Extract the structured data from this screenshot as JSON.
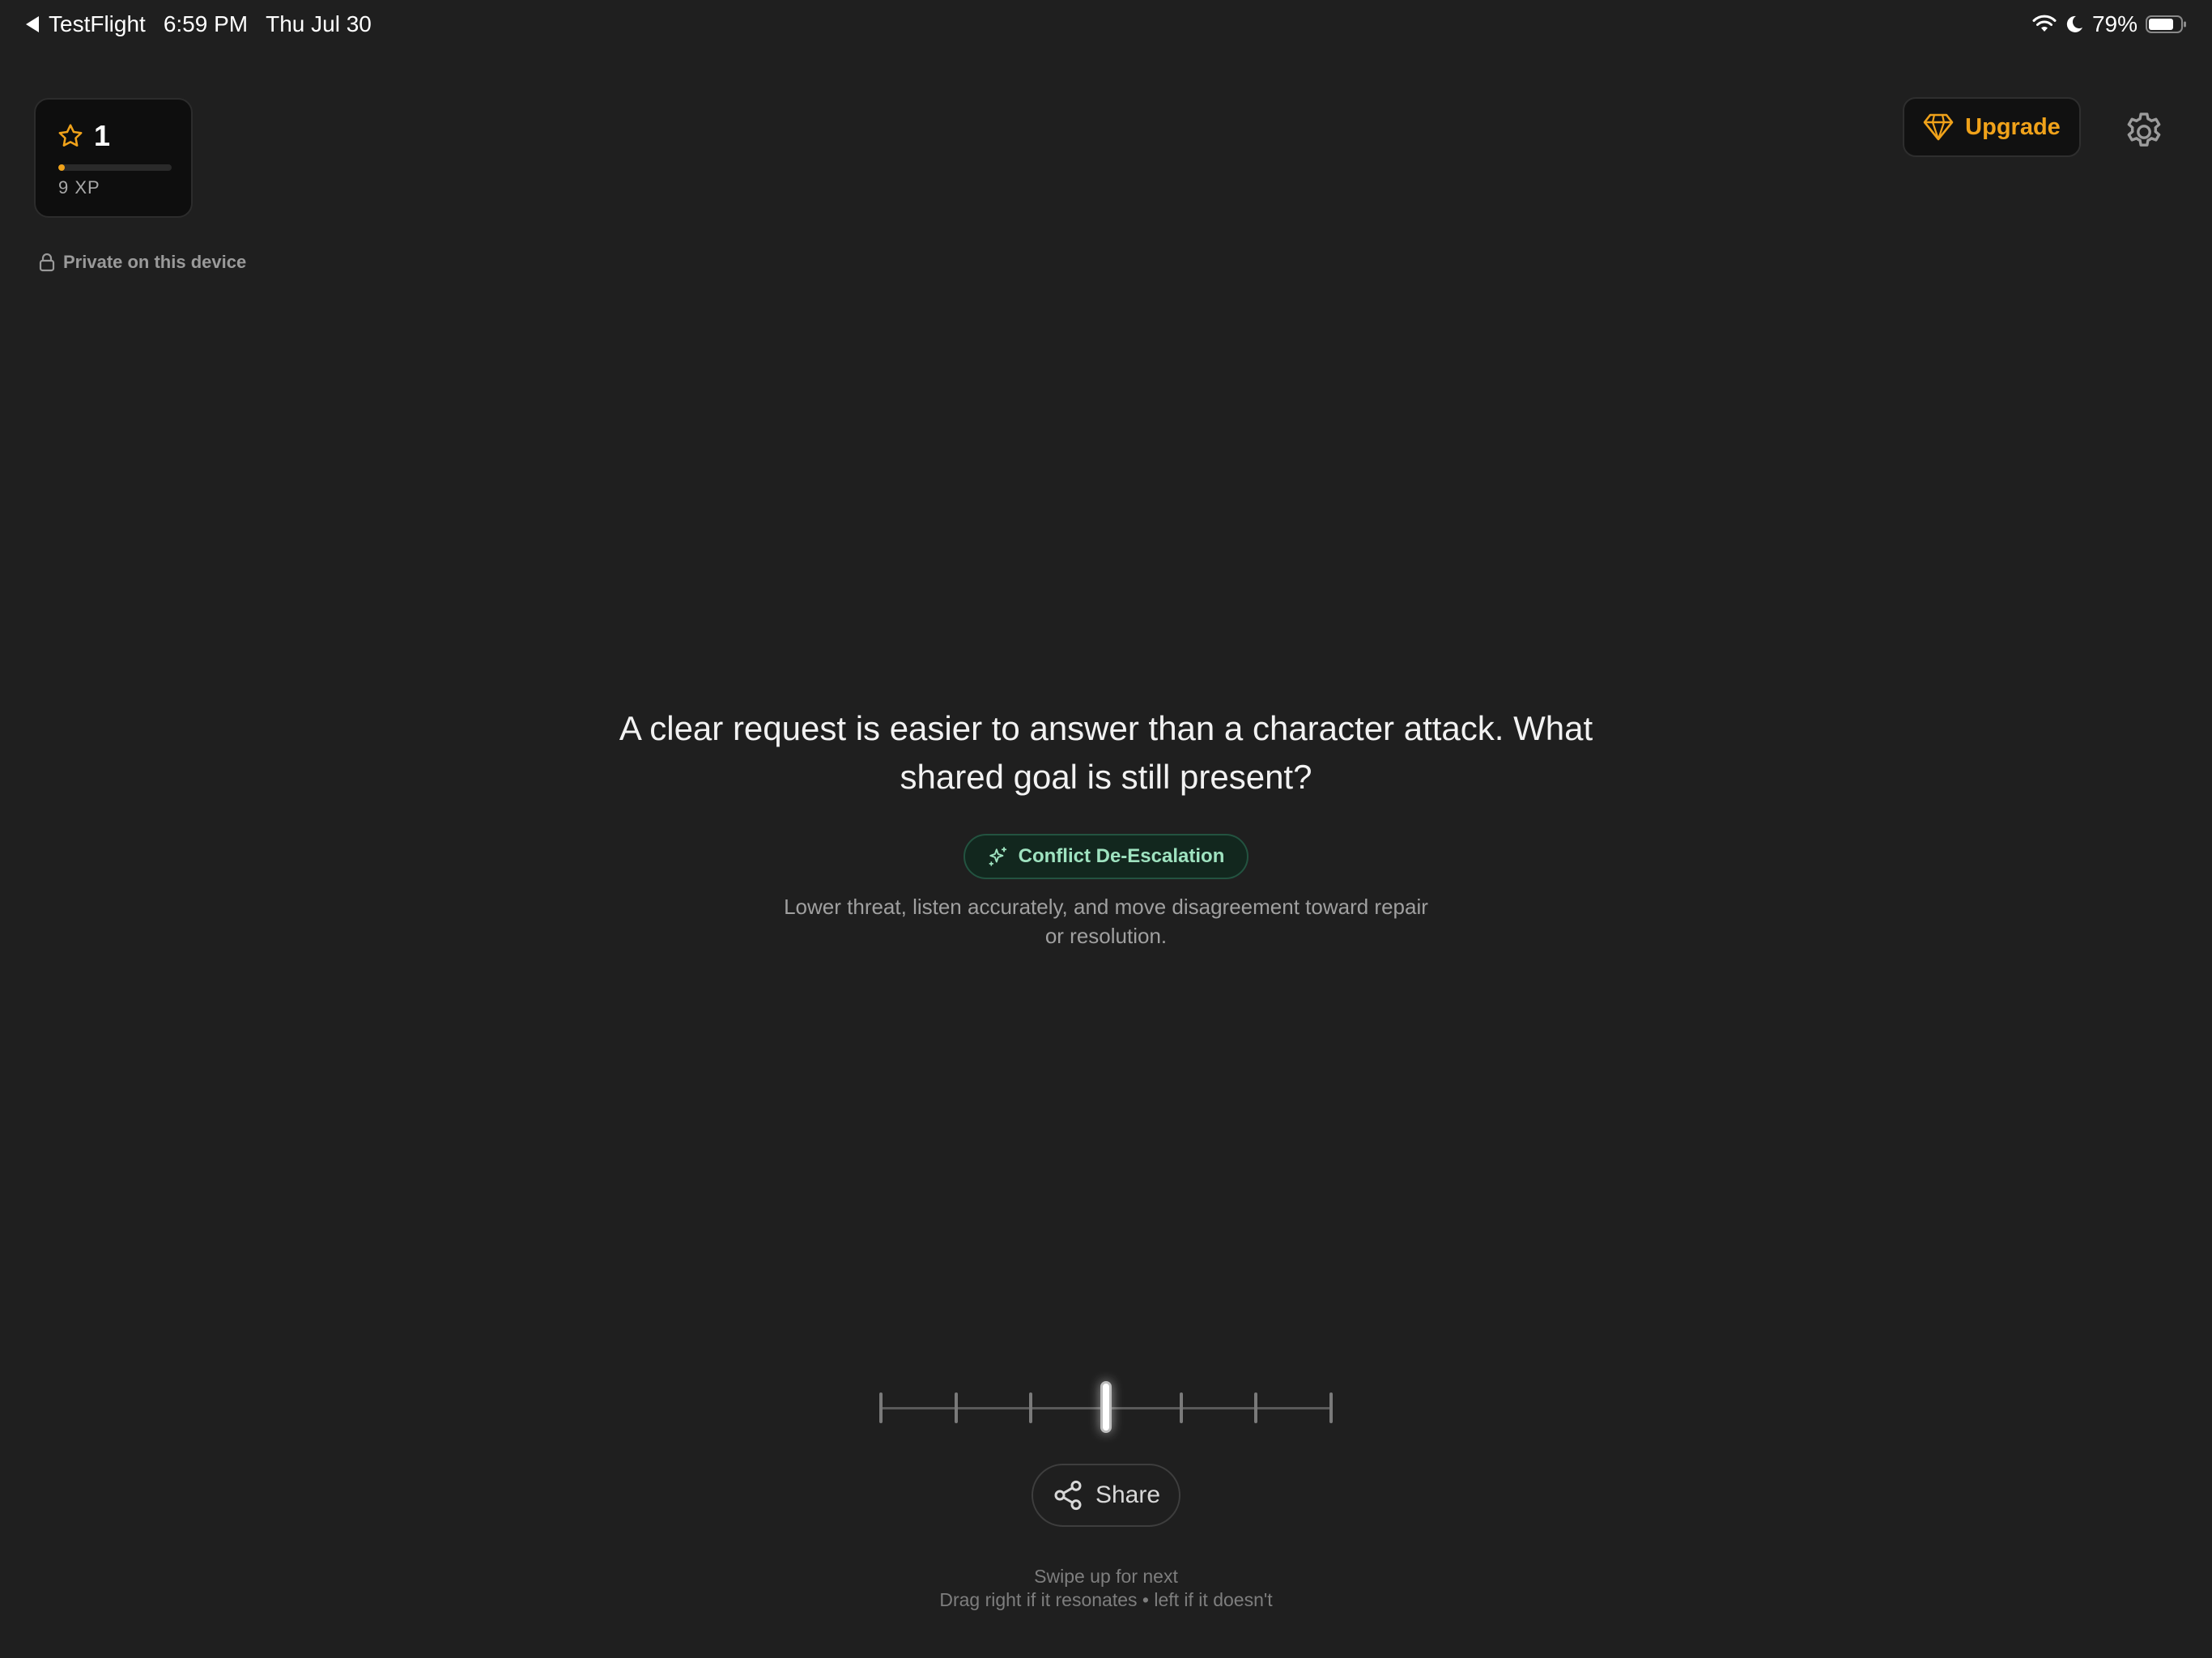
{
  "status_bar": {
    "back_label": "TestFlight",
    "time": "6:59 PM",
    "date": "Thu Jul 30",
    "battery_percent": "79%",
    "battery_level": 0.79,
    "icons": [
      "back-arrow-icon",
      "wifi-icon",
      "moon-icon",
      "battery-icon"
    ]
  },
  "level_card": {
    "level": "1",
    "xp_label": "9 XP",
    "xp_progress": 0.06,
    "icon": "star-icon",
    "accent_color": "#f0a21a"
  },
  "privacy": {
    "label": "Private on this device",
    "icon": "lock-icon"
  },
  "header": {
    "upgrade_label": "Upgrade",
    "upgrade_icon": "diamond-icon",
    "upgrade_color": "#f0a21a",
    "settings_icon": "gear-icon"
  },
  "prompt": {
    "text": "A clear request is easier to answer than a character attack. What shared goal is still present?"
  },
  "category": {
    "label": "Conflict De-Escalation",
    "icon": "sparkle-icon",
    "chip_color": "#9fe3c0",
    "description": "Lower threat, listen accurately, and move disagreement toward repair or resolution."
  },
  "rating_slider": {
    "tick_count": 7,
    "selected_index": 3
  },
  "share": {
    "label": "Share",
    "icon": "share-icon"
  },
  "hints": {
    "line1": "Swipe up for next",
    "line2": "Drag right if it resonates • left if it doesn't"
  }
}
